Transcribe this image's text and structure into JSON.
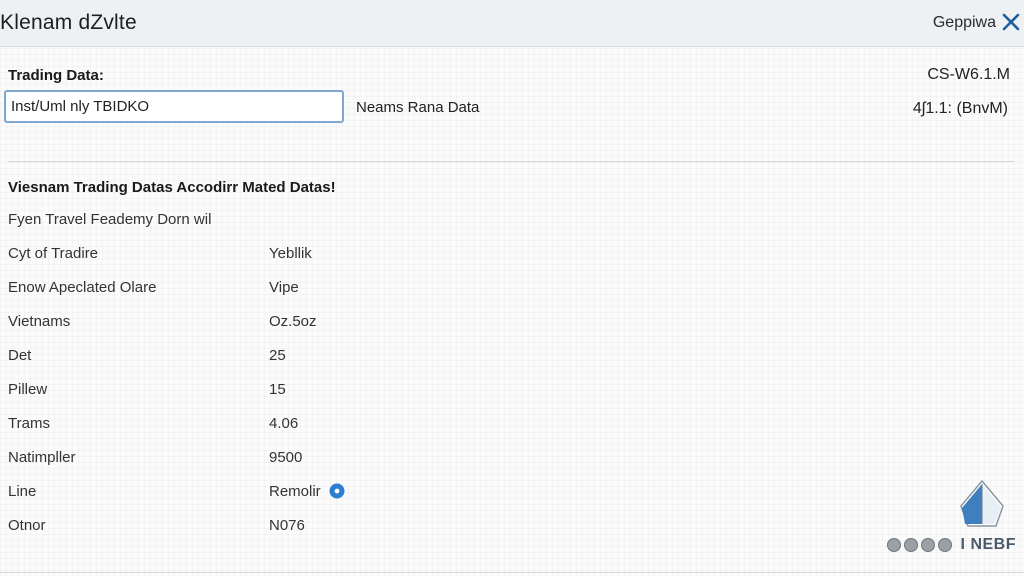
{
  "window": {
    "title": "Klenam dZvlte",
    "menu_label": "Geppiwa",
    "close_icon": "close-icon"
  },
  "header": {
    "section_label": "Trading Data:",
    "meta_right_1": "CS-W6.1.M",
    "meta_right_2": "4ʃ1.1: (BnvM)"
  },
  "search": {
    "value": "Inst/Uml nly TBIDKO",
    "field_label": "Neams Rana Data"
  },
  "content": {
    "heading": "Viesnam Trading Datas Accodirr Mated Datas!",
    "subheading": "Fyen Travel Feademy Dorn wil",
    "rows": [
      {
        "label": "Cyt of Tradire",
        "value": "Yebllik"
      },
      {
        "label": "Enow Apeclated Olare",
        "value": "Vipe"
      },
      {
        "label": "Vietnams",
        "value": "Oz.5oz"
      },
      {
        "label": "Det",
        "value": "25"
      },
      {
        "label": "Pillew",
        "value": "15"
      },
      {
        "label": "Trams",
        "value": "4.06"
      },
      {
        "label": "Natimpller",
        "value": "9500"
      },
      {
        "label": "Line",
        "value": "Remolir"
      },
      {
        "label": "Otnor",
        "value": "N076"
      }
    ],
    "info_icon": "info-icon"
  },
  "footer": {
    "brand_text": "I NEBF",
    "icons": [
      "circle-icon",
      "circle-icon",
      "circle-icon",
      "circle-icon"
    ],
    "logo_icon": "compass-logo-icon"
  },
  "colors": {
    "accent": "#2a7fd0",
    "input_border": "#7fa7cf",
    "titlebar": "#eef1f4"
  }
}
